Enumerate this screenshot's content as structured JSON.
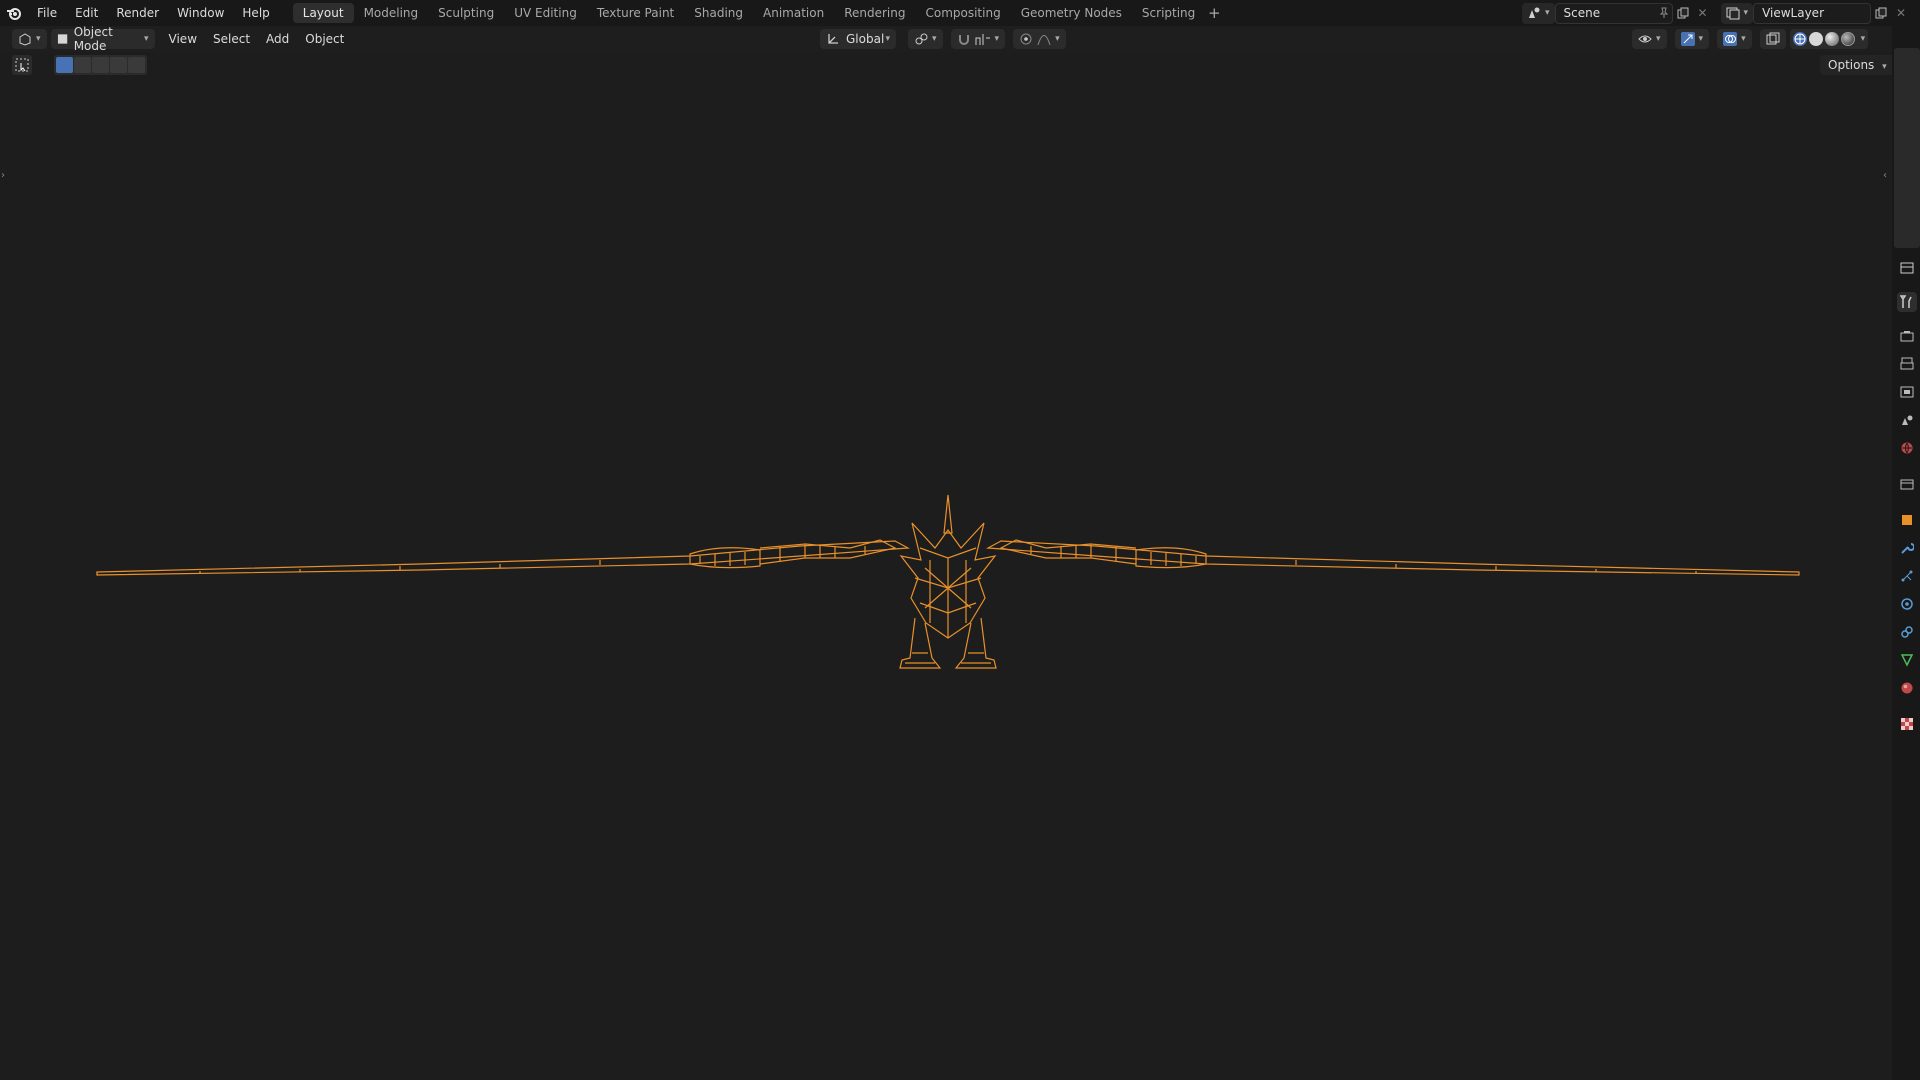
{
  "app": {
    "logo_icon": "blender-logo-icon"
  },
  "menu": [
    "File",
    "Edit",
    "Render",
    "Window",
    "Help"
  ],
  "workspaces": {
    "tabs": [
      "Layout",
      "Modeling",
      "Sculpting",
      "UV Editing",
      "Texture Paint",
      "Shading",
      "Animation",
      "Rendering",
      "Compositing",
      "Geometry Nodes",
      "Scripting"
    ],
    "active": "Layout",
    "add_label": "+"
  },
  "scene": {
    "name": "Scene"
  },
  "view_layer": {
    "name": "ViewLayer"
  },
  "header": {
    "mode": "Object Mode",
    "menus": [
      "View",
      "Select",
      "Add",
      "Object"
    ],
    "transform_orientation": "Global"
  },
  "toolbar": {
    "options_label": "Options"
  },
  "colors": {
    "accent_blue": "#4772b3",
    "wireframe_orange": "#e8902a",
    "background": "#1d1d1d",
    "topbar": "#181818"
  },
  "properties_tabs": [
    "tool-icon",
    "render-icon",
    "output-icon",
    "view-layer-icon",
    "scene-icon",
    "world-icon",
    "collection-icon",
    "object-icon",
    "modifier-icon",
    "particles-icon",
    "physics-icon",
    "constraints-icon",
    "data-icon",
    "material-icon",
    "texture-icon"
  ]
}
